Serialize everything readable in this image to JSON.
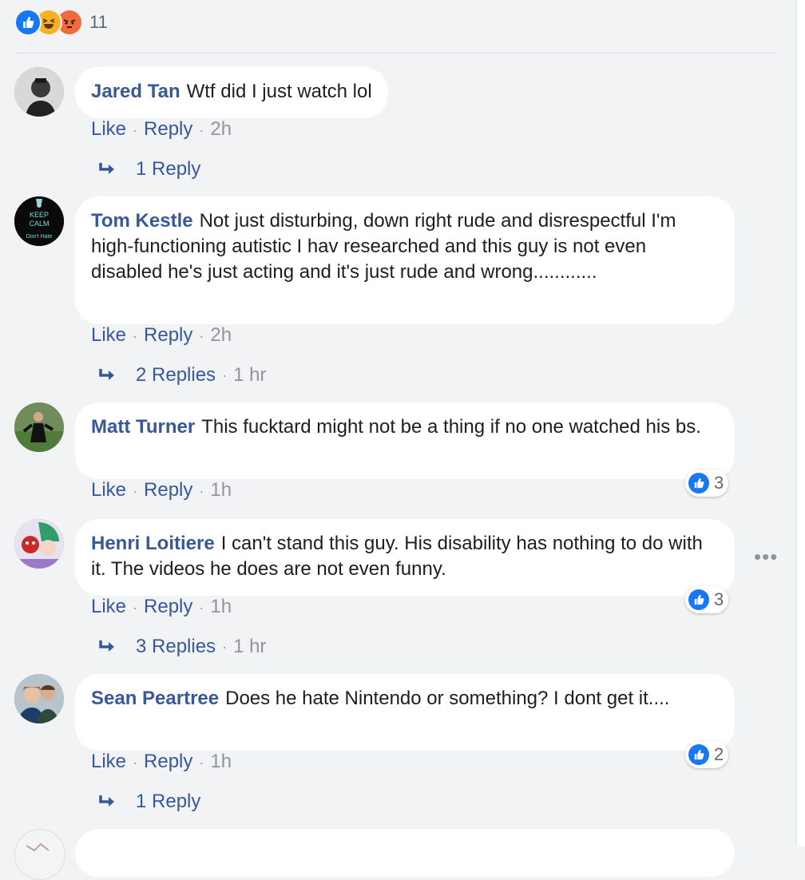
{
  "reactions": {
    "icons": [
      "like-icon",
      "haha-icon",
      "angry-icon"
    ],
    "count": "11"
  },
  "actions": {
    "like": "Like",
    "reply": "Reply",
    "dot": "·"
  },
  "comments": [
    {
      "author": "Jared Tan",
      "text": "Wtf did I just watch lol",
      "time": "2h",
      "replies": {
        "label": "1 Reply",
        "time": ""
      },
      "likes": ""
    },
    {
      "author": "Tom Kestle",
      "text": "Not just disturbing, down right rude and disrespectful I'm high-functioning autistic I hav researched and this guy is not even disabled he's just acting and it's just rude and wrong............",
      "time": "2h",
      "replies": {
        "label": "2 Replies",
        "time": "1 hr"
      },
      "likes": "",
      "avatar_text": [
        "KEEP",
        "CALM",
        "Don't Hate"
      ]
    },
    {
      "author": "Matt Turner",
      "text": "This fucktard might not be a thing if no one watched his bs.",
      "time": "1h",
      "replies": null,
      "likes": "3"
    },
    {
      "author": "Henri Loitiere",
      "text": "I can't stand this guy. His disability has nothing to do with it. The videos he does are not even funny.",
      "time": "1h",
      "replies": {
        "label": "3 Replies",
        "time": "1 hr"
      },
      "likes": "3",
      "more": "•••"
    },
    {
      "author": "Sean Peartree",
      "text": "Does he hate Nintendo or something? I dont get it....",
      "time": "1h",
      "replies": {
        "label": "1 Reply",
        "time": ""
      },
      "likes": "2"
    }
  ],
  "colors": {
    "background": "#f2f3f5",
    "author": "#385898",
    "like_blue": "#1877f2",
    "meta_gray": "#90949c"
  }
}
